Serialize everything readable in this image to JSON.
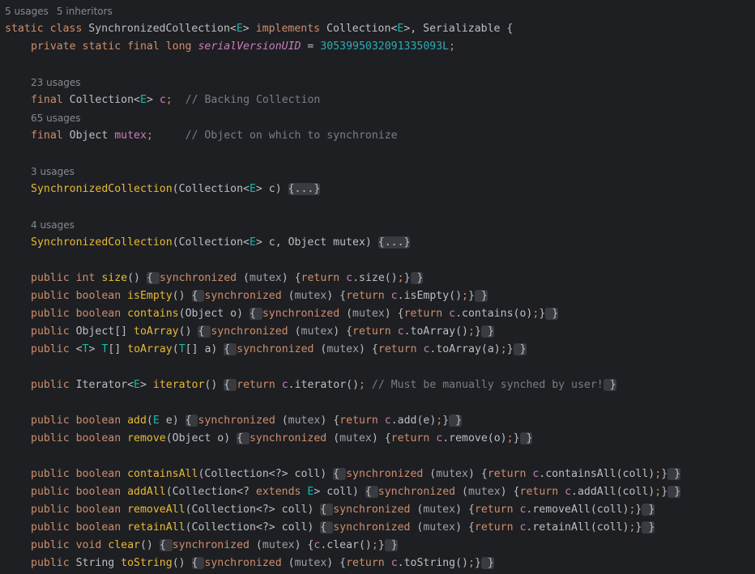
{
  "editor": {
    "colors": {
      "background": "#1e1f22",
      "keyword": "#cf8e6d",
      "identifier": "#bcbec4",
      "method": "#56a8f5",
      "field": "#c77dbb",
      "number": "#2aacb8",
      "comment": "#7a7e85",
      "type_parameter": "#16baac",
      "fold_background": "#393b40",
      "inlay_hint": "#868a91"
    },
    "lines": [
      {
        "hint": [
          "5 usages",
          "5 inheritors"
        ],
        "indent": 0
      },
      {
        "indent": 0,
        "tokens": [
          [
            "static class ",
            "kw"
          ],
          [
            "SynchronizedCollection",
            "def"
          ],
          [
            "<",
            "def"
          ],
          [
            "E",
            "tp"
          ],
          [
            "> ",
            "def"
          ],
          [
            "implements ",
            "kw"
          ],
          [
            "Collection",
            "def"
          ],
          [
            "<",
            "def"
          ],
          [
            "E",
            "tp"
          ],
          [
            ">, ",
            "def"
          ],
          [
            "Serializable",
            "def"
          ],
          [
            " {",
            "def"
          ]
        ]
      },
      {
        "indent": 1,
        "tokens": [
          [
            "private static final long ",
            "kw"
          ],
          [
            "serialVersionUID",
            "sfld"
          ],
          [
            " = ",
            "def"
          ],
          [
            "3053995032091335093L",
            "num"
          ],
          [
            ";",
            "kw"
          ]
        ]
      },
      {
        "blank": true
      },
      {
        "hint": [
          "23 usages"
        ],
        "indent": 1
      },
      {
        "indent": 1,
        "tokens": [
          [
            "final ",
            "kw"
          ],
          [
            "Collection",
            "def"
          ],
          [
            "<",
            "def"
          ],
          [
            "E",
            "tp"
          ],
          [
            "> ",
            "def"
          ],
          [
            "c",
            "fld"
          ],
          [
            ";",
            "kw"
          ],
          [
            "  // Backing Collection",
            "cmt"
          ]
        ]
      },
      {
        "hint": [
          "65 usages"
        ],
        "indent": 1
      },
      {
        "indent": 1,
        "tokens": [
          [
            "final ",
            "kw"
          ],
          [
            "Object ",
            "def"
          ],
          [
            "mutex",
            "fld"
          ],
          [
            ";",
            "kw"
          ],
          [
            "     // Object on which to synchronize",
            "cmt"
          ]
        ]
      },
      {
        "blank": true
      },
      {
        "hint": [
          "3 usages"
        ],
        "indent": 1
      },
      {
        "indent": 1,
        "tokens": [
          [
            "SynchronizedCollection",
            "ctor"
          ],
          [
            "(Collection<",
            "def"
          ],
          [
            "E",
            "tp"
          ],
          [
            "> c) ",
            "def"
          ],
          [
            "{...}",
            "fold"
          ]
        ]
      },
      {
        "blank": true
      },
      {
        "hint": [
          "4 usages"
        ],
        "indent": 1
      },
      {
        "indent": 1,
        "tokens": [
          [
            "SynchronizedCollection",
            "ctor"
          ],
          [
            "(Collection<",
            "def"
          ],
          [
            "E",
            "tp"
          ],
          [
            "> c, Object mutex) ",
            "def"
          ],
          [
            "{...}",
            "fold"
          ]
        ]
      },
      {
        "blank": true
      },
      {
        "indent": 1,
        "tokens": [
          [
            "public int ",
            "kw"
          ],
          [
            "size",
            "ctor"
          ],
          [
            "() ",
            "def"
          ],
          [
            "{ ",
            "fold"
          ],
          [
            "synchronized",
            "sync"
          ],
          [
            " (",
            "def"
          ],
          [
            "mutex",
            "mtx"
          ],
          [
            ") {",
            "def"
          ],
          [
            "return ",
            "kw"
          ],
          [
            "c",
            "fld"
          ],
          [
            ".size()",
            "def"
          ],
          [
            ";",
            "kw"
          ],
          [
            "}",
            "def"
          ],
          [
            " }",
            "fold"
          ]
        ]
      },
      {
        "indent": 1,
        "tokens": [
          [
            "public boolean ",
            "kw"
          ],
          [
            "isEmpty",
            "ctor"
          ],
          [
            "() ",
            "def"
          ],
          [
            "{ ",
            "fold"
          ],
          [
            "synchronized",
            "sync"
          ],
          [
            " (",
            "def"
          ],
          [
            "mutex",
            "mtx"
          ],
          [
            ") {",
            "def"
          ],
          [
            "return ",
            "kw"
          ],
          [
            "c",
            "fld"
          ],
          [
            ".isEmpty()",
            "def"
          ],
          [
            ";",
            "kw"
          ],
          [
            "}",
            "def"
          ],
          [
            " }",
            "fold"
          ]
        ]
      },
      {
        "indent": 1,
        "tokens": [
          [
            "public boolean ",
            "kw"
          ],
          [
            "contains",
            "ctor"
          ],
          [
            "(Object o) ",
            "def"
          ],
          [
            "{ ",
            "fold"
          ],
          [
            "synchronized",
            "sync"
          ],
          [
            " (",
            "def"
          ],
          [
            "mutex",
            "mtx"
          ],
          [
            ") {",
            "def"
          ],
          [
            "return ",
            "kw"
          ],
          [
            "c",
            "fld"
          ],
          [
            ".contains(o)",
            "def"
          ],
          [
            ";",
            "kw"
          ],
          [
            "}",
            "def"
          ],
          [
            " }",
            "fold"
          ]
        ]
      },
      {
        "indent": 1,
        "tokens": [
          [
            "public ",
            "kw"
          ],
          [
            "Object[] ",
            "def"
          ],
          [
            "toArray",
            "ctor"
          ],
          [
            "() ",
            "def"
          ],
          [
            "{ ",
            "fold"
          ],
          [
            "synchronized",
            "sync"
          ],
          [
            " (",
            "def"
          ],
          [
            "mutex",
            "mtx"
          ],
          [
            ") {",
            "def"
          ],
          [
            "return ",
            "kw"
          ],
          [
            "c",
            "fld"
          ],
          [
            ".toArray()",
            "def"
          ],
          [
            ";",
            "kw"
          ],
          [
            "}",
            "def"
          ],
          [
            " }",
            "fold"
          ]
        ]
      },
      {
        "indent": 1,
        "tokens": [
          [
            "public ",
            "kw"
          ],
          [
            "<",
            "def"
          ],
          [
            "T",
            "tp"
          ],
          [
            "> ",
            "def"
          ],
          [
            "T",
            "tp"
          ],
          [
            "[] ",
            "def"
          ],
          [
            "toArray",
            "ctor"
          ],
          [
            "(",
            "def"
          ],
          [
            "T",
            "tp"
          ],
          [
            "[] a) ",
            "def"
          ],
          [
            "{ ",
            "fold"
          ],
          [
            "synchronized",
            "sync"
          ],
          [
            " (",
            "def"
          ],
          [
            "mutex",
            "mtx"
          ],
          [
            ") {",
            "def"
          ],
          [
            "return ",
            "kw"
          ],
          [
            "c",
            "fld"
          ],
          [
            ".toArray(a)",
            "def"
          ],
          [
            ";",
            "kw"
          ],
          [
            "}",
            "def"
          ],
          [
            " }",
            "fold"
          ]
        ]
      },
      {
        "blank": true
      },
      {
        "indent": 1,
        "tokens": [
          [
            "public ",
            "kw"
          ],
          [
            "Iterator<",
            "def"
          ],
          [
            "E",
            "tp"
          ],
          [
            "> ",
            "def"
          ],
          [
            "iterator",
            "ctor"
          ],
          [
            "() ",
            "def"
          ],
          [
            "{ ",
            "fold"
          ],
          [
            "return ",
            "kw"
          ],
          [
            "c",
            "fld"
          ],
          [
            ".iterator()",
            "def"
          ],
          [
            ";",
            "kw"
          ],
          [
            " // Must be manually synched by user!",
            "cmt"
          ],
          [
            " }",
            "fold"
          ]
        ]
      },
      {
        "blank": true
      },
      {
        "indent": 1,
        "tokens": [
          [
            "public boolean ",
            "kw"
          ],
          [
            "add",
            "ctor"
          ],
          [
            "(",
            "def"
          ],
          [
            "E",
            "tp"
          ],
          [
            " e) ",
            "def"
          ],
          [
            "{ ",
            "fold"
          ],
          [
            "synchronized",
            "sync"
          ],
          [
            " (",
            "def"
          ],
          [
            "mutex",
            "mtx"
          ],
          [
            ") {",
            "def"
          ],
          [
            "return ",
            "kw"
          ],
          [
            "c",
            "fld"
          ],
          [
            ".add(e)",
            "def"
          ],
          [
            ";",
            "kw"
          ],
          [
            "}",
            "def"
          ],
          [
            " }",
            "fold"
          ]
        ]
      },
      {
        "indent": 1,
        "tokens": [
          [
            "public boolean ",
            "kw"
          ],
          [
            "remove",
            "ctor"
          ],
          [
            "(Object o) ",
            "def"
          ],
          [
            "{ ",
            "fold"
          ],
          [
            "synchronized",
            "sync"
          ],
          [
            " (",
            "def"
          ],
          [
            "mutex",
            "mtx"
          ],
          [
            ") {",
            "def"
          ],
          [
            "return ",
            "kw"
          ],
          [
            "c",
            "fld"
          ],
          [
            ".remove(o)",
            "def"
          ],
          [
            ";",
            "kw"
          ],
          [
            "}",
            "def"
          ],
          [
            " }",
            "fold"
          ]
        ]
      },
      {
        "blank": true
      },
      {
        "indent": 1,
        "tokens": [
          [
            "public boolean ",
            "kw"
          ],
          [
            "containsAll",
            "ctor"
          ],
          [
            "(Collection<?> coll) ",
            "def"
          ],
          [
            "{ ",
            "fold"
          ],
          [
            "synchronized",
            "sync"
          ],
          [
            " (",
            "def"
          ],
          [
            "mutex",
            "mtx"
          ],
          [
            ") {",
            "def"
          ],
          [
            "return ",
            "kw"
          ],
          [
            "c",
            "fld"
          ],
          [
            ".containsAll(coll)",
            "def"
          ],
          [
            ";",
            "kw"
          ],
          [
            "}",
            "def"
          ],
          [
            " }",
            "fold"
          ]
        ]
      },
      {
        "indent": 1,
        "tokens": [
          [
            "public boolean ",
            "kw"
          ],
          [
            "addAll",
            "ctor"
          ],
          [
            "(Collection<? ",
            "def"
          ],
          [
            "extends ",
            "kw"
          ],
          [
            "E",
            "tp"
          ],
          [
            "> coll) ",
            "def"
          ],
          [
            "{ ",
            "fold"
          ],
          [
            "synchronized",
            "sync"
          ],
          [
            " (",
            "def"
          ],
          [
            "mutex",
            "mtx"
          ],
          [
            ") {",
            "def"
          ],
          [
            "return ",
            "kw"
          ],
          [
            "c",
            "fld"
          ],
          [
            ".addAll(coll)",
            "def"
          ],
          [
            ";",
            "kw"
          ],
          [
            "}",
            "def"
          ],
          [
            " }",
            "fold"
          ]
        ]
      },
      {
        "indent": 1,
        "tokens": [
          [
            "public boolean ",
            "kw"
          ],
          [
            "removeAll",
            "ctor"
          ],
          [
            "(Collection<?> coll) ",
            "def"
          ],
          [
            "{ ",
            "fold"
          ],
          [
            "synchronized",
            "sync"
          ],
          [
            " (",
            "def"
          ],
          [
            "mutex",
            "mtx"
          ],
          [
            ") {",
            "def"
          ],
          [
            "return ",
            "kw"
          ],
          [
            "c",
            "fld"
          ],
          [
            ".removeAll(coll)",
            "def"
          ],
          [
            ";",
            "kw"
          ],
          [
            "}",
            "def"
          ],
          [
            " }",
            "fold"
          ]
        ]
      },
      {
        "indent": 1,
        "tokens": [
          [
            "public boolean ",
            "kw"
          ],
          [
            "retainAll",
            "ctor"
          ],
          [
            "(Collection<?> coll) ",
            "def"
          ],
          [
            "{ ",
            "fold"
          ],
          [
            "synchronized",
            "sync"
          ],
          [
            " (",
            "def"
          ],
          [
            "mutex",
            "mtx"
          ],
          [
            ") {",
            "def"
          ],
          [
            "return ",
            "kw"
          ],
          [
            "c",
            "fld"
          ],
          [
            ".retainAll(coll)",
            "def"
          ],
          [
            ";",
            "kw"
          ],
          [
            "}",
            "def"
          ],
          [
            " }",
            "fold"
          ]
        ]
      },
      {
        "indent": 1,
        "tokens": [
          [
            "public void ",
            "kw"
          ],
          [
            "clear",
            "ctor"
          ],
          [
            "() ",
            "def"
          ],
          [
            "{ ",
            "fold"
          ],
          [
            "synchronized",
            "sync"
          ],
          [
            " (",
            "def"
          ],
          [
            "mutex",
            "mtx"
          ],
          [
            ") {",
            "def"
          ],
          [
            "c",
            "fld"
          ],
          [
            ".clear()",
            "def"
          ],
          [
            ";",
            "kw"
          ],
          [
            "}",
            "def"
          ],
          [
            " }",
            "fold"
          ]
        ]
      },
      {
        "indent": 1,
        "tokens": [
          [
            "public ",
            "kw"
          ],
          [
            "String ",
            "def"
          ],
          [
            "toString",
            "ctor"
          ],
          [
            "() ",
            "def"
          ],
          [
            "{ ",
            "fold"
          ],
          [
            "synchronized",
            "sync"
          ],
          [
            " (",
            "def"
          ],
          [
            "mutex",
            "mtx"
          ],
          [
            ") {",
            "def"
          ],
          [
            "return ",
            "kw"
          ],
          [
            "c",
            "fld"
          ],
          [
            ".toString()",
            "def"
          ],
          [
            ";",
            "kw"
          ],
          [
            "}",
            "def"
          ],
          [
            " }",
            "fold"
          ]
        ]
      }
    ]
  }
}
